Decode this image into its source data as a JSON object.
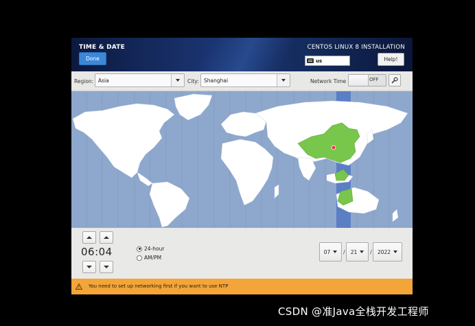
{
  "header": {
    "title": "TIME & DATE",
    "done_label": "Done",
    "install_title": "CENTOS LINUX 8 INSTALLATION",
    "keyboard_layout": "us",
    "help_label": "Help!"
  },
  "toolbar": {
    "region_label": "Region:",
    "region_value": "Asia",
    "city_label": "City:",
    "city_value": "Shanghai",
    "network_time_label": "Network Time",
    "network_time_state": "OFF"
  },
  "map": {
    "ocean_color": "#8ea7cc",
    "land_color": "#ffffff",
    "selected_region_color": "#78c64c",
    "timezone_band_color": "#5b7fc4",
    "marker_color": "#e24040"
  },
  "clock": {
    "time": "06:04",
    "format_24h_label": "24-hour",
    "format_ampm_label": "AM/PM",
    "selected_format": "24-hour"
  },
  "date": {
    "month": "07",
    "day": "21",
    "year": "2022",
    "separator": "/"
  },
  "warning": {
    "text": "You need to set up networking first if you want to use NTP",
    "color": "#f3a53a"
  },
  "watermark": "CSDN @准Java全栈开发工程师"
}
